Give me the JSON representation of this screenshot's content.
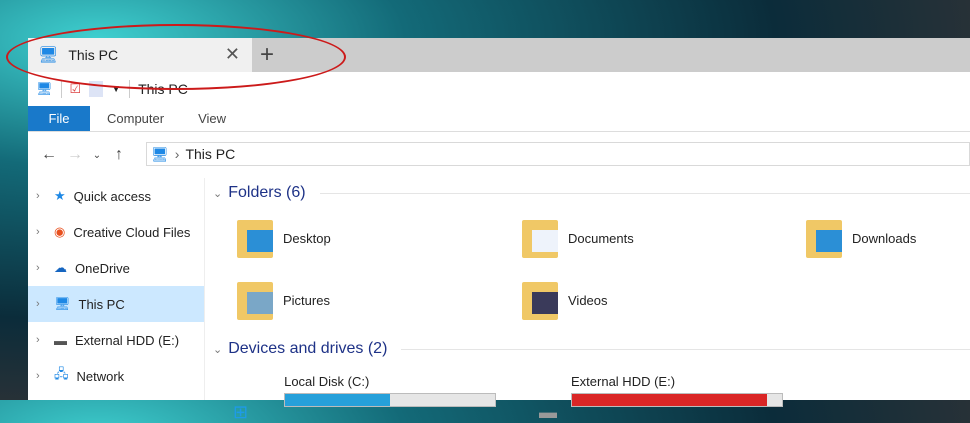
{
  "tab": {
    "title": "This PC",
    "close": "✕",
    "new_tab": "+"
  },
  "qat": {
    "location": "This PC"
  },
  "ribbon": {
    "tabs": [
      "File",
      "Computer",
      "View"
    ]
  },
  "address": {
    "path": "This PC"
  },
  "nav": [
    {
      "label": "Quick access",
      "icon": "star-icon"
    },
    {
      "label": "Creative Cloud Files",
      "icon": "creative-cloud-icon"
    },
    {
      "label": "OneDrive",
      "icon": "cloud-icon"
    },
    {
      "label": "This PC",
      "icon": "computer-icon",
      "selected": true
    },
    {
      "label": "External HDD (E:)",
      "icon": "drive-icon"
    },
    {
      "label": "Network",
      "icon": "network-icon"
    }
  ],
  "folders": {
    "header": "Folders (6)",
    "items": [
      "Desktop",
      "Documents",
      "Downloads",
      "Pictures",
      "Videos"
    ]
  },
  "devices": {
    "header": "Devices and drives (2)",
    "drives": [
      {
        "label": "Local Disk (C:)",
        "used_fraction": 0.5,
        "color": "#26a0da"
      },
      {
        "label": "External HDD (E:)",
        "used_fraction": 0.93,
        "color": "#da2626"
      }
    ]
  }
}
